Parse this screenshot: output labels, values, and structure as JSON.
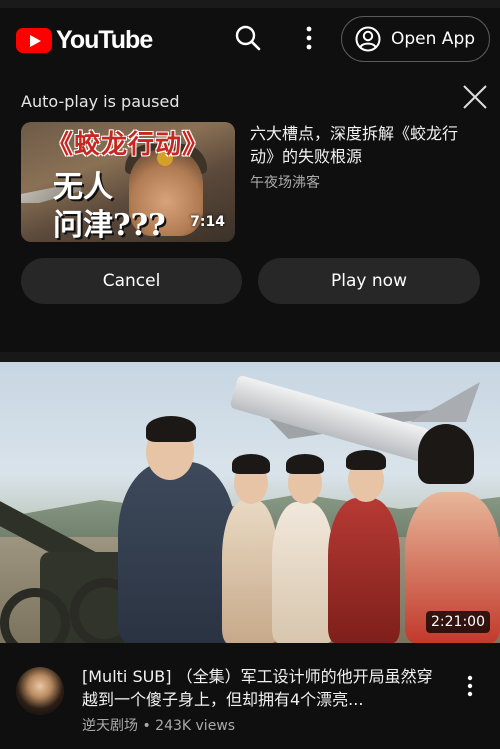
{
  "header": {
    "logo_text": "YouTube",
    "open_app_label": "Open App",
    "brand_color": "#ff0000"
  },
  "autoplay": {
    "title": "Auto-play is paused",
    "thumbnail": {
      "headline": "《蛟龙行动》",
      "line1": "无人",
      "line2": "问津???",
      "duration": "7:14"
    },
    "video_title": "六大槽点，深度拆解《蛟龙行动》的失败根源",
    "channel": "午夜场沸客",
    "cancel_label": "Cancel",
    "play_now_label": "Play now"
  },
  "video": {
    "duration": "2:21:00",
    "title": "[Multi SUB] （全集）军工设计师的他开局虽然穿越到一个傻子身上，但却拥有4个漂亮...",
    "channel": "逆天剧场",
    "views": "243K views",
    "separator": "•"
  },
  "icons": [
    "youtube-logo-icon",
    "search-icon",
    "more-vert-icon",
    "account-circle-icon",
    "close-icon",
    "more-vert-icon"
  ]
}
